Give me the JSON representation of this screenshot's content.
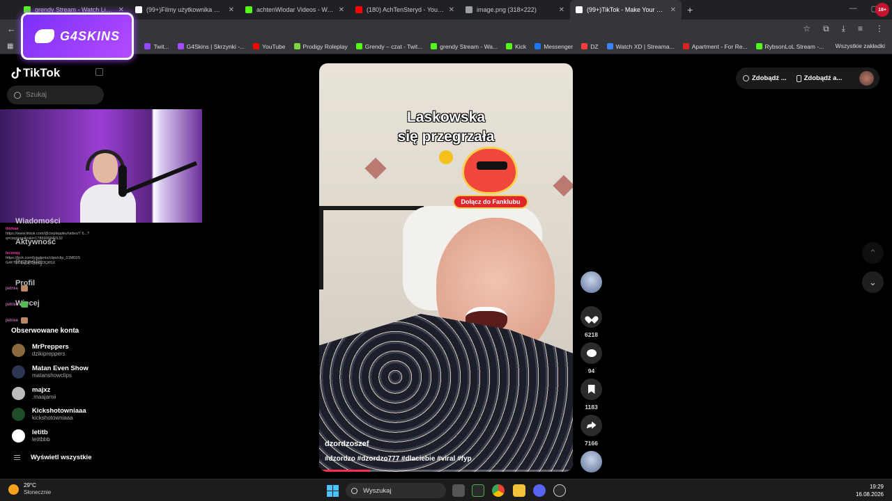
{
  "browser": {
    "tabs": [
      {
        "title": "grendy Stream - Watch Live on Kick",
        "color": "#53fc18"
      },
      {
        "title": "(99+)Filmy użytkownika Marcin",
        "color": "#ffffff"
      },
      {
        "title": "achtenWlodar Videos - Watch Kick",
        "color": "#53fc18"
      },
      {
        "title": "(180) AchTenSteryd - YouTube",
        "color": "#ff0000"
      },
      {
        "title": "image.png (318×222)",
        "color": "#9aa0a6"
      },
      {
        "title": "(99+)TikTok - Make Your Day",
        "color": "#ffffff",
        "active": true
      }
    ],
    "new_tab_glyph": "+",
    "age_badge": "18+"
  },
  "bookmarks": {
    "items": [
      {
        "label": "Twit...",
        "color": "#9146ff"
      },
      {
        "label": "G4Skins | Skrzynki -...",
        "color": "#a24cff"
      },
      {
        "label": "YouTube",
        "color": "#ff0000"
      },
      {
        "label": "Prodigy Roleplay",
        "color": "#7bd63f"
      },
      {
        "label": "Grendy – czat - Twit...",
        "color": "#53fc18"
      },
      {
        "label": "grendy Stream - Wa...",
        "color": "#53fc18"
      },
      {
        "label": "Kick",
        "color": "#53fc18"
      },
      {
        "label": "Messenger",
        "color": "#1877f2"
      },
      {
        "label": "DZ",
        "color": "#ff3b3b"
      },
      {
        "label": "Watch XD | Streama...",
        "color": "#3b82f6"
      },
      {
        "label": "Apartment - For Re...",
        "color": "#d22"
      },
      {
        "label": "RybsonLoL Stream -...",
        "color": "#53fc18"
      }
    ],
    "all_bookmarks": "Wszystkie zakładki"
  },
  "overlay": {
    "brand": "G4SKINS"
  },
  "sidebar": {
    "logo": "TikTok",
    "search_placeholder": "Szukaj",
    "nav_under": [
      "Wiadomości",
      "Aktywność",
      "Prześlij",
      "Profil",
      "Więcej"
    ],
    "chat_lines": [
      {
        "user": "ibizkaa",
        "text": "https://www.tiktok.com/@ciepleppikv/video/7 6...? q=ciepleppiko&t=1786900940132"
      },
      {
        "user": "lxczeqq",
        "text": "https://kick.com/lojadenis/clips/clip_01M03S G4FTKD6HGPD6H0J3Q8SX"
      }
    ],
    "chat_users": [
      "petrixe",
      "petrixe",
      "petrixe"
    ],
    "following_title": "Obserwowane konta",
    "accounts": [
      {
        "name": "MrPreppers",
        "handle": "dzikipreppers",
        "color": "#8a6a3c"
      },
      {
        "name": "Matan Even Show",
        "handle": "matanshowclips",
        "color": "#2d3550"
      },
      {
        "name": "majxz",
        "handle": ".maajamii",
        "color": "#bbbbbb"
      },
      {
        "name": "Kickshotowniaaa",
        "handle": "kickshotowniaaa",
        "color": "#1f4d2a"
      },
      {
        "name": "letitb",
        "handle": "letitbbb",
        "color": "#ffffff"
      }
    ],
    "see_all": "Wyświetl wszystkie"
  },
  "header": {
    "btn_coins": "Zdobądź ...",
    "btn_app": "Zdobądź a..."
  },
  "video": {
    "caption_line1": "Laskowska",
    "caption_line2": "się przegrzała",
    "fanclub": "Dołącz do Fanklubu",
    "author": "dzordzoszef",
    "hashtags": "#dzordzo #dzordzo777 #dlaciebie #viral #fyp",
    "progress_fraction": 0.2
  },
  "actions": {
    "likes": "6218",
    "comments": "94",
    "saves": "1183",
    "shares": "7166"
  },
  "taskbar": {
    "temperature": "29°C",
    "weather": "Słonecznie",
    "search": "Wyszukaj",
    "time": "19:29",
    "date": "16.08.2026"
  }
}
